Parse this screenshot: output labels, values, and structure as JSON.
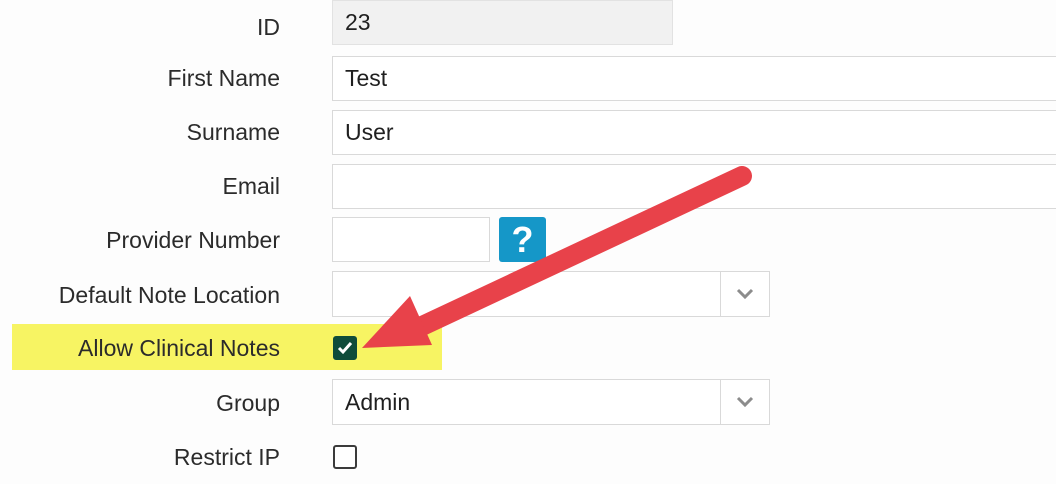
{
  "form": {
    "id": {
      "label": "ID",
      "value": "23"
    },
    "first_name": {
      "label": "First Name",
      "value": "Test"
    },
    "surname": {
      "label": "Surname",
      "value": "User"
    },
    "email": {
      "label": "Email",
      "value": ""
    },
    "provider_number": {
      "label": "Provider Number",
      "value": "",
      "help_text": "?"
    },
    "default_note_location": {
      "label": "Default Note Location",
      "value": ""
    },
    "allow_clinical_notes": {
      "label": "Allow Clinical Notes",
      "checked": true
    },
    "group": {
      "label": "Group",
      "value": "Admin"
    },
    "restrict_ip": {
      "label": "Restrict IP",
      "checked": false
    }
  },
  "annotation": {
    "highlight_color": "#f7f463",
    "arrow_color": "#e8424a"
  },
  "colors": {
    "checkbox_checked": "#0f4c3a",
    "help_button": "#1597c8"
  }
}
